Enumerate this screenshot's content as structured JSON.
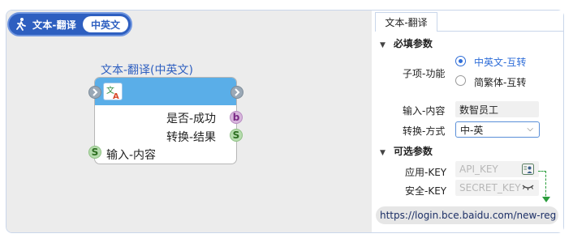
{
  "header": {
    "title": "文本-翻译",
    "badge": "中英文"
  },
  "node": {
    "caption": "文本-翻译(中英文)",
    "outputs": [
      {
        "label": "是否-成功",
        "badge": "b"
      },
      {
        "label": "转换-结果",
        "badge": "S"
      }
    ],
    "input": {
      "label": "输入-内容",
      "badge": "S"
    }
  },
  "panel": {
    "tab": "文本-翻译",
    "required": {
      "title": "必填参数",
      "sub_function": {
        "label": "子项-功能",
        "options": [
          {
            "label": "中英文-互转",
            "selected": true
          },
          {
            "label": "简繁体-互转",
            "selected": false
          }
        ]
      },
      "input_content": {
        "label": "输入-内容",
        "value": "数智员工"
      },
      "convert_mode": {
        "label": "转换-方式",
        "value": "中-英"
      }
    },
    "optional": {
      "title": "可选参数",
      "app_key": {
        "label": "应用-KEY",
        "placeholder": "API_KEY"
      },
      "secret_key": {
        "label": "安全-KEY",
        "placeholder": "SECRET_KEY"
      }
    },
    "register_url": "https://login.bce.baidu.com/new-reg"
  },
  "colors": {
    "accent": "#2e5fc0",
    "node_header": "#5aaee8",
    "link": "#2a9d3c"
  }
}
